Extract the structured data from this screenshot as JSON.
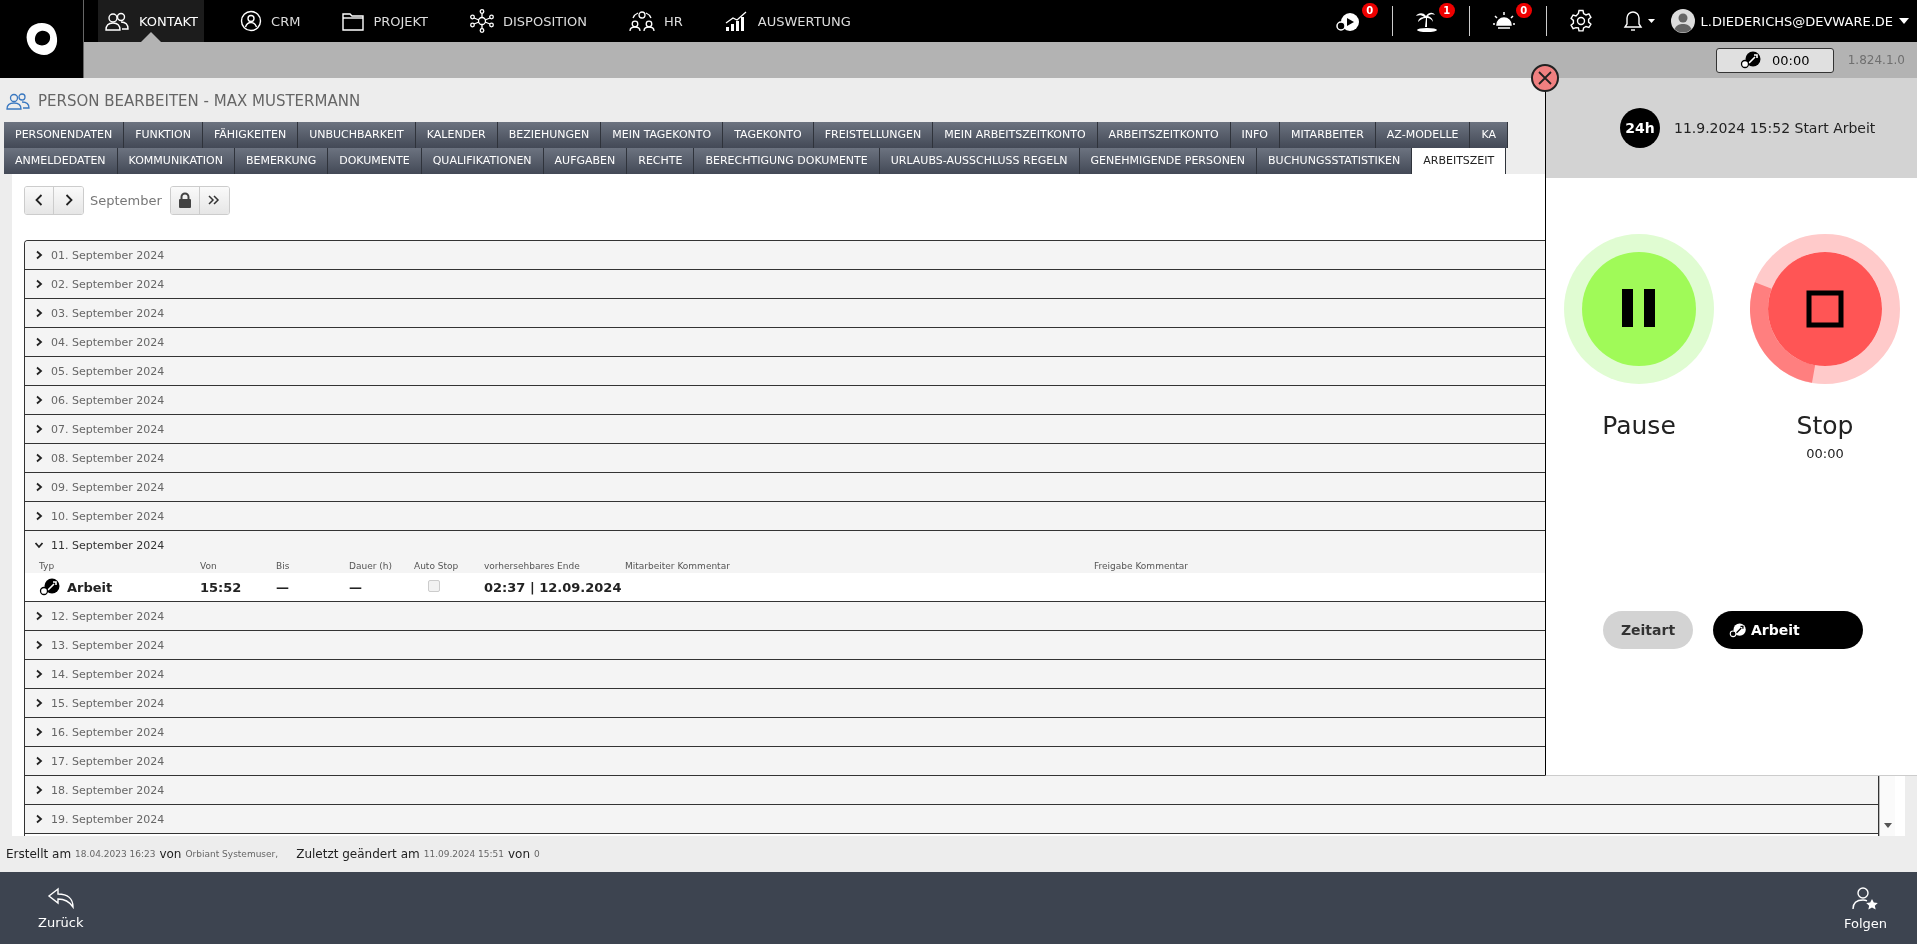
{
  "nav": {
    "items": [
      {
        "label": "KONTAKT",
        "selected": true
      },
      {
        "label": "CRM",
        "selected": false
      },
      {
        "label": "PROJEKT",
        "selected": false
      },
      {
        "label": "DISPOSITION",
        "selected": false
      },
      {
        "label": "HR",
        "selected": false
      },
      {
        "label": "AUSWERTUNG",
        "selected": false
      }
    ]
  },
  "notifications": [
    {
      "count": "0"
    },
    {
      "count": "1"
    },
    {
      "count": "0"
    }
  ],
  "user": {
    "email": "L.DIEDERICHS@DEVWARE.DE"
  },
  "timer_button": {
    "label": "00:00"
  },
  "version": "1.824.1.0",
  "page_title": "PERSON BEARBEITEN - MAX MUSTERMANN",
  "tabs_row1": [
    {
      "label": "PERSONENDATEN",
      "selected": false
    },
    {
      "label": "FUNKTION",
      "selected": false
    },
    {
      "label": "FÄHIGKEITEN",
      "selected": false
    },
    {
      "label": "UNBUCHBARKEIT",
      "selected": false
    },
    {
      "label": "KALENDER",
      "selected": false
    },
    {
      "label": "BEZIEHUNGEN",
      "selected": false
    },
    {
      "label": "MEIN TAGEKONTO",
      "selected": false
    },
    {
      "label": "TAGEKONTO",
      "selected": false
    },
    {
      "label": "FREISTELLUNGEN",
      "selected": false
    },
    {
      "label": "MEIN ARBEITSZEITKONTO",
      "selected": false
    },
    {
      "label": "ARBEITSZEITKONTO",
      "selected": false
    },
    {
      "label": "INFO",
      "selected": false
    },
    {
      "label": "MITARBEITER",
      "selected": false
    },
    {
      "label": "AZ-MODELLE",
      "selected": false
    },
    {
      "label": "KA",
      "selected": false
    }
  ],
  "tabs_row2": [
    {
      "label": "ANMELDEDATEN",
      "selected": false
    },
    {
      "label": "KOMMUNIKATION",
      "selected": false
    },
    {
      "label": "BEMERKUNG",
      "selected": false
    },
    {
      "label": "DOKUMENTE",
      "selected": false
    },
    {
      "label": "QUALIFIKATIONEN",
      "selected": false
    },
    {
      "label": "AUFGABEN",
      "selected": false
    },
    {
      "label": "RECHTE",
      "selected": false
    },
    {
      "label": "BERECHTIGUNG DOKUMENTE",
      "selected": false
    },
    {
      "label": "URLAUBS-AUSSCHLUSS REGELN",
      "selected": false
    },
    {
      "label": "GENEHMIGENDE PERSONEN",
      "selected": false
    },
    {
      "label": "BUCHUNGSSTATISTIKEN",
      "selected": false
    },
    {
      "label": "ARBEITSZEIT",
      "selected": true
    }
  ],
  "toolbar": {
    "month": "September"
  },
  "columns": [
    "Typ",
    "Von",
    "Bis",
    "Dauer (h)",
    "Auto Stop",
    "vorhersehbares Ende",
    "Mitarbeiter Kommentar",
    "Freigabe Kommentar"
  ],
  "days": [
    {
      "label": "01. September 2024",
      "expanded": false
    },
    {
      "label": "02. September 2024",
      "expanded": false
    },
    {
      "label": "03. September 2024",
      "expanded": false
    },
    {
      "label": "04. September 2024",
      "expanded": false
    },
    {
      "label": "05. September 2024",
      "expanded": false
    },
    {
      "label": "06. September 2024",
      "expanded": false
    },
    {
      "label": "07. September 2024",
      "expanded": false
    },
    {
      "label": "08. September 2024",
      "expanded": false
    },
    {
      "label": "09. September 2024",
      "expanded": false
    },
    {
      "label": "10. September 2024",
      "expanded": false
    },
    {
      "label": "11. September 2024",
      "expanded": true,
      "entries": [
        {
          "typ": "Arbeit",
          "von": "15:52",
          "bis": "—",
          "dauer": "—",
          "auto_stop": false,
          "ende": "02:37 | 12.09.2024"
        }
      ]
    },
    {
      "label": "12. September 2024",
      "expanded": false
    },
    {
      "label": "13. September 2024",
      "expanded": false
    },
    {
      "label": "14. September 2024",
      "expanded": false
    },
    {
      "label": "15. September 2024",
      "expanded": false
    },
    {
      "label": "16. September 2024",
      "expanded": false
    },
    {
      "label": "17. September 2024",
      "expanded": false
    },
    {
      "label": "18. September 2024",
      "expanded": false
    },
    {
      "label": "19. September 2024",
      "expanded": false
    }
  ],
  "record_info": {
    "created_label": "Erstellt am",
    "created_at": "18.04.2023 16:23",
    "created_by_label": "von",
    "created_by": "Orbiant Systemuser,",
    "changed_label": "Zuletzt geändert am",
    "changed_at": "11.09.2024 15:51",
    "changed_by_label": "von",
    "changed_by": "0"
  },
  "panel": {
    "badge": "24h",
    "status": "11.9.2024 15:52 Start Arbeit",
    "pause_label": "Pause",
    "stop": {
      "label": "Stop",
      "time": "00:00",
      "level": 0.28
    },
    "type_label": "Zeitart",
    "type_value": "Arbeit"
  },
  "bottom_bar": {
    "back": "Zurück",
    "follow": "Folgen"
  }
}
